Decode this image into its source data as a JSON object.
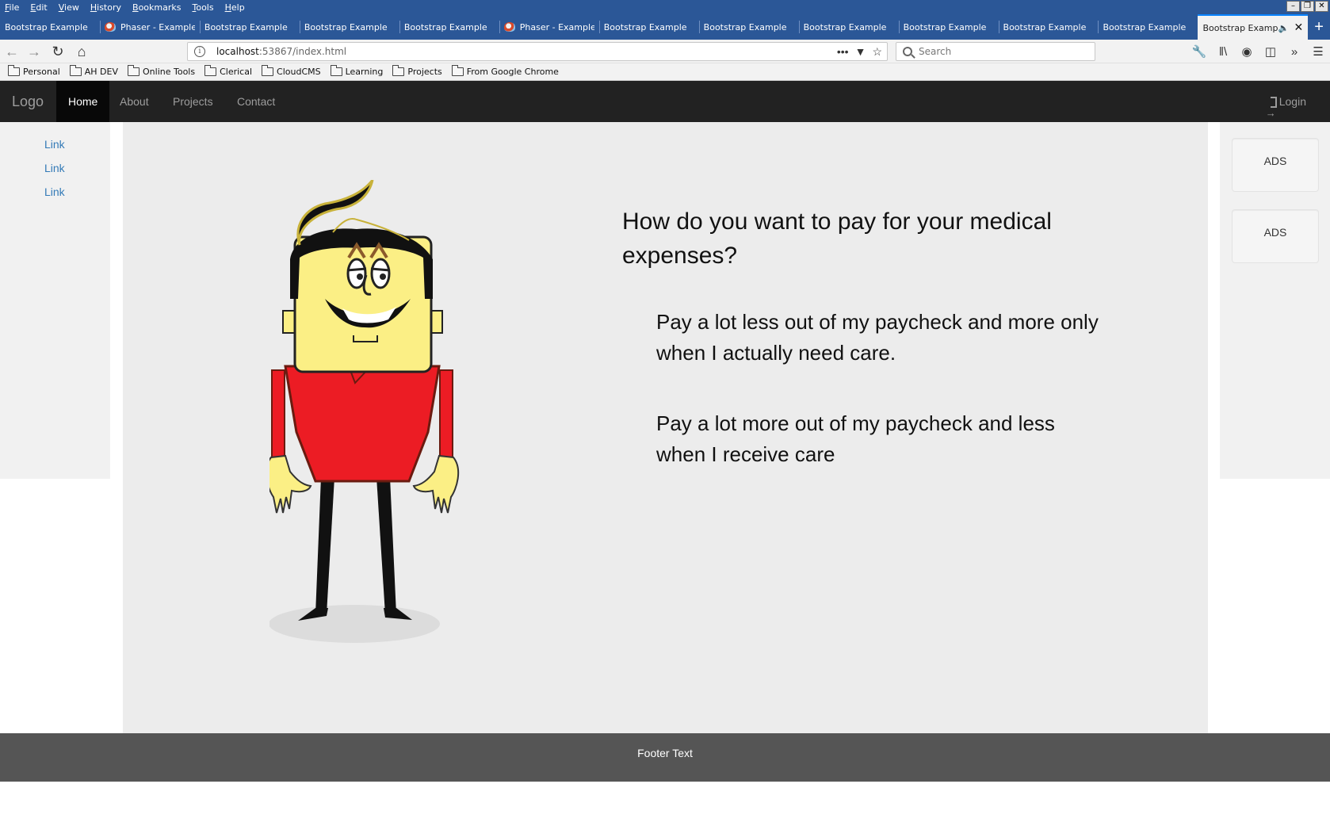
{
  "browser": {
    "menu": [
      "File",
      "Edit",
      "View",
      "History",
      "Bookmarks",
      "Tools",
      "Help"
    ],
    "window_buttons": [
      "minimize",
      "restore",
      "close"
    ],
    "tabs": [
      {
        "label": "Bootstrap Example",
        "icon": "none"
      },
      {
        "label": "Phaser - Example",
        "icon": "phaser-icon"
      },
      {
        "label": "Bootstrap Example",
        "icon": "none"
      },
      {
        "label": "Bootstrap Example",
        "icon": "none"
      },
      {
        "label": "Bootstrap Example",
        "icon": "none"
      },
      {
        "label": "Phaser - Example",
        "icon": "phaser-icon"
      },
      {
        "label": "Bootstrap Example",
        "icon": "none"
      },
      {
        "label": "Bootstrap Example",
        "icon": "none"
      },
      {
        "label": "Bootstrap Example",
        "icon": "none"
      },
      {
        "label": "Bootstrap Example",
        "icon": "none"
      },
      {
        "label": "Bootstrap Example",
        "icon": "none"
      },
      {
        "label": "Bootstrap Example",
        "icon": "none"
      },
      {
        "label": "Bootstrap Example",
        "icon": "none",
        "active": true
      }
    ],
    "url_host": "localhost",
    "url_rest": ":53867/index.html",
    "search_placeholder": "Search",
    "bookmarks": [
      "Personal",
      "AH DEV",
      "Online Tools",
      "Clerical",
      "CloudCMS",
      "Learning",
      "Projects",
      "From Google Chrome"
    ],
    "colors": {
      "chrome": "#2b5797",
      "toolbar": "#f2f2f2"
    }
  },
  "site": {
    "brand": "Logo",
    "nav": [
      {
        "label": "Home",
        "active": true
      },
      {
        "label": "About"
      },
      {
        "label": "Projects"
      },
      {
        "label": "Contact"
      }
    ],
    "login": "Login",
    "side_links": [
      "Link",
      "Link",
      "Link"
    ],
    "ads": [
      "ADS",
      "ADS"
    ],
    "question": "How do you want to pay for your medical expenses?",
    "answers": [
      "Pay a lot less out of my paycheck and more only when I actually need care.",
      "Pay a lot more out of my paycheck and less when I receive care"
    ],
    "footer": "Footer Text",
    "colors": {
      "navbar": "#222222",
      "link": "#337ab7",
      "main_bg": "#ececec",
      "footer": "#555555"
    }
  }
}
